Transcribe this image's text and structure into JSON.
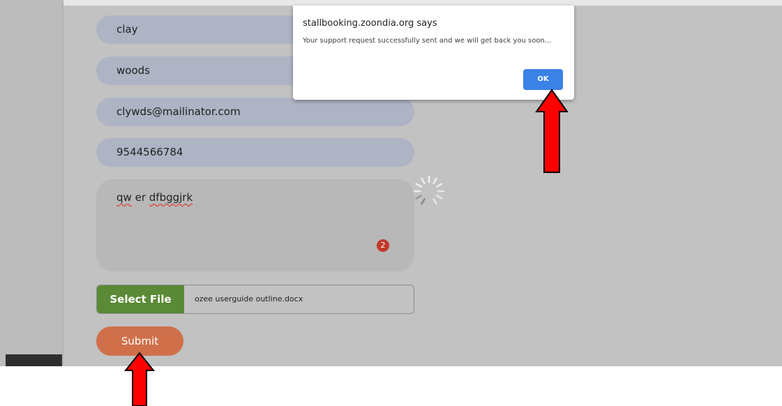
{
  "form": {
    "first_name": "clay",
    "last_name": "woods",
    "email": "clywds@mailinator.com",
    "phone": "9544566784",
    "message_word1": "qw",
    "message_word2": "er",
    "message_word3": "dfbggjrk",
    "error_count": "2",
    "file_button_label": "Select File",
    "file_name": "ozee userguide outline.docx",
    "submit_label": "Submit"
  },
  "dialog": {
    "title": "stallbooking.zoondia.org says",
    "message": "Your support request successfully sent and we will get back you soon...",
    "ok_label": "OK"
  },
  "colors": {
    "arrow": "#ff0000",
    "submit": "#d0704a",
    "file_button": "#5a8a35",
    "ok_button": "#3b82e6",
    "field_fill": "#aeb4c4"
  }
}
